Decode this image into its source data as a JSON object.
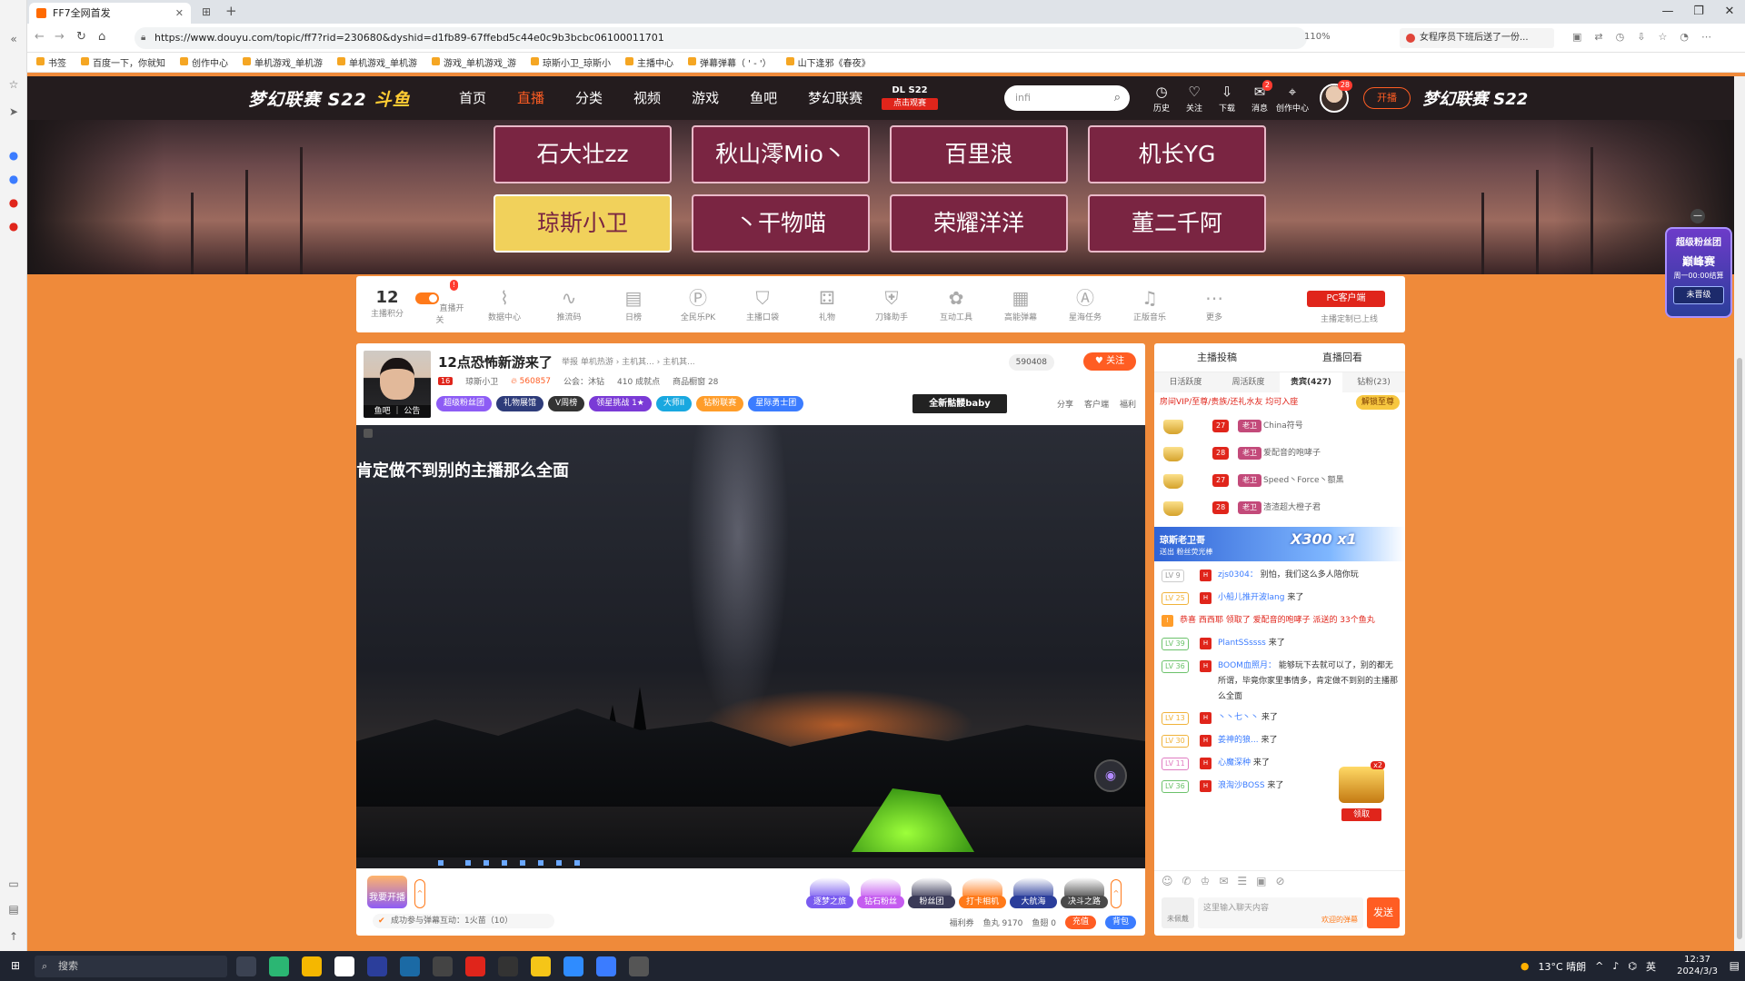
{
  "browser": {
    "tab_title": "FF7全网首发",
    "url": "https://www.douyu.com/topic/ff7?rid=230680&dyshid=d1fb89-67ffebd5c44e0c9b3bcbc06100011701",
    "zoom": "110%",
    "ext_ad": "女程序员下班后送了一份...",
    "bookmarks": [
      "书签",
      "百度一下，你就知",
      "创作中心",
      "单机游戏_单机游",
      "单机游戏_单机游",
      "游戏_单机游戏_游",
      "琼斯小卫_琼斯小",
      "主播中心",
      "弹幕弹幕（ ' - '）",
      "山下逢邪《春夜》"
    ]
  },
  "header": {
    "brand_left": "梦幻联赛 S22",
    "brand_logo": "斗鱼",
    "nav": [
      "首页",
      "直播",
      "分类",
      "视频",
      "游戏",
      "鱼吧",
      "梦幻联赛"
    ],
    "dl_title": "DL S22",
    "dl_sub": "点击观赛",
    "search_placeholder": "infi",
    "icons": [
      {
        "label": "历史",
        "badge": ""
      },
      {
        "label": "关注",
        "badge": ""
      },
      {
        "label": "下载",
        "badge": ""
      },
      {
        "label": "消息",
        "badge": "2"
      },
      {
        "label": "创作中心",
        "badge": ""
      }
    ],
    "avatar_badge": "28",
    "live_btn": "开播",
    "brand_right": "梦幻联赛 S22"
  },
  "banner": {
    "buttons": [
      "石大壮zz",
      "秋山澪Mio丶",
      "百里浪",
      "机长YG",
      "琼斯小卫",
      "丶干物喵",
      "荣耀洋洋",
      "董二千阿"
    ]
  },
  "tools": {
    "score": "12",
    "score_label": "主播积分",
    "items": [
      "直播开关",
      "数据中心",
      "推流码",
      "日榜",
      "全民乐PK",
      "主播口袋",
      "礼物",
      "刀锋助手",
      "互动工具",
      "高能弹幕",
      "星海任务",
      "正版音乐",
      "更多"
    ],
    "toggle_badge": "!",
    "pc_btn": "PC客户端",
    "pc_sub": "主播定制已上线"
  },
  "room": {
    "title": "12点恐怖新游来了",
    "crumbs": "举报   单机热游 › 主机其... › 主机其...",
    "avatar_caption": "鱼吧 ｜ 公告",
    "level": "16",
    "streamer": "琼斯小卫",
    "hot": "560857",
    "guild": "公会：沐钻",
    "chain": "410 成就点",
    "bag": "商品橱窗 28",
    "count": "590408",
    "follow": "关注",
    "tags": [
      {
        "text": "超级粉丝团",
        "color": "#8d5cf5"
      },
      {
        "text": "礼物展馆",
        "color": "#2e3c7a"
      },
      {
        "text": "V周榜",
        "color": "#333333"
      },
      {
        "text": "领星挑战 1★",
        "color": "#7a3ad6"
      },
      {
        "text": "大师II",
        "color": "#19a8e0"
      },
      {
        "text": "钻粉联赛",
        "color": "#ff9d2a"
      },
      {
        "text": "星际勇士团",
        "color": "#3b7cff"
      }
    ],
    "skull_badge": "全新骷髅baby",
    "share": [
      "分享",
      "客户端",
      "福利"
    ]
  },
  "video": {
    "caption": "肯定做不到别的主播那么全面"
  },
  "gifts": {
    "start_live": "我要开播",
    "items": [
      {
        "label": "逐梦之旅",
        "color": "#7a5cf0"
      },
      {
        "label": "钻石粉丝",
        "color": "#c55cf0"
      },
      {
        "label": "粉丝团",
        "color": "#3a3a58"
      },
      {
        "label": "打卡相机",
        "color": "#ff7a1a"
      },
      {
        "label": "大航海",
        "color": "#2b3e9b"
      },
      {
        "label": "决斗之路",
        "color": "#4a4a4a"
      }
    ],
    "status": "成功参与弹幕互动：1火苗（10）",
    "welfare": "福利券",
    "fish_balls": "鱼丸 9170",
    "fish_fin": "鱼翅 0",
    "charge": "充值",
    "bag": "背包"
  },
  "chat": {
    "top_tabs": [
      "主播投稿",
      "直播回看"
    ],
    "tabs": [
      "日活跃度",
      "周活跃度",
      "贵宾(427)",
      "钻粉(23)"
    ],
    "vip_text": "房间VIP/至尊/贵族/还礼水友 均可入座",
    "vip_join": "解锁至尊",
    "ranks": [
      {
        "lv": "27",
        "badge": "老卫",
        "name": "China符号"
      },
      {
        "lv": "28",
        "badge": "老卫",
        "name": "爱配音的咆哮子"
      },
      {
        "lv": "27",
        "badge": "老卫",
        "name": "Speed丶Force丶额黑"
      },
      {
        "lv": "28",
        "badge": "老卫",
        "name": "渣渣超大橙子君"
      }
    ],
    "promo_title": "琼斯老卫哥",
    "promo_sub": "送出  粉丝荧光棒",
    "promo_count": "X300 x1",
    "messages": [
      {
        "lv": "LV 9",
        "user": "zjs0304：",
        "text": "别怕，我们这么多人陪你玩"
      },
      {
        "lv": "LV 25",
        "user": "小船儿推开波lang",
        "text": "来了"
      },
      {
        "lv": "",
        "user": "西西耶",
        "text": "恭喜 西西耶 领取了 爱配音的咆哮子 派送的 33个鱼丸"
      },
      {
        "lv": "LV 39",
        "user": "PlantSSssss",
        "text": "来了"
      },
      {
        "lv": "LV 36",
        "user": "BOOM血照月：",
        "text": "能够玩下去就可以了，别的都无所谓，毕竟你家里事情多，肯定做不到别的主播那么全面"
      },
      {
        "lv": "LV 13",
        "user": "丶丶七丶丶",
        "text": "来了"
      },
      {
        "lv": "LV 30",
        "user": "姜神的狼...",
        "text": "来了"
      },
      {
        "lv": "LV 11",
        "user": "心魔深种",
        "text": "来了"
      },
      {
        "lv": "LV 36",
        "user": "浪淘沙BOSS",
        "text": "来了"
      }
    ],
    "treasure_x": "x2",
    "treasure_claim": "领取",
    "noble": "未佩戴",
    "input_placeholder": "这里输入聊天内容",
    "input_hint": "欢迎的弹幕",
    "send": "发送"
  },
  "widget": {
    "w1": "超级粉丝团",
    "w2": "巅峰赛",
    "w3": "周一00:00结算",
    "w4": "未晋级"
  },
  "taskbar": {
    "search": "搜索",
    "weather": "13°C 晴朗",
    "lang": "英",
    "time": "12:37",
    "date": "2024/3/3"
  }
}
